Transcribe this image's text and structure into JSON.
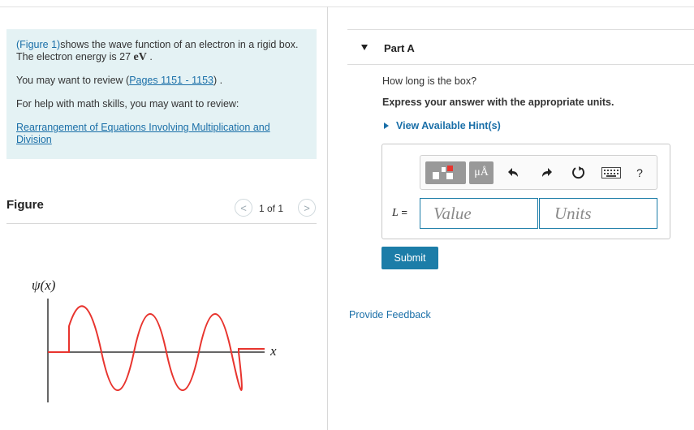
{
  "info": {
    "figure_link": "(Figure 1)",
    "line1_rest": "shows the wave function of an electron in a rigid box. The electron energy is 27 ",
    "energy_unit": "eV",
    "line1_end": " .",
    "review_prefix": "You may want to review (",
    "review_link": "Pages 1151 - 1153",
    "review_suffix": ") .",
    "math_help": "For help with math skills, you may want to review:",
    "math_link": "Rearrangement of Equations Involving Multiplication and Division"
  },
  "figure": {
    "title": "Figure",
    "counter": "1 of 1",
    "prev_glyph": "<",
    "next_glyph": ">",
    "y_label": "ψ(x)",
    "x_label": "x"
  },
  "part": {
    "title": "Part A",
    "question": "How long is the box?",
    "instruction": "Express your answer with the appropriate units.",
    "hint": "View Available Hint(s)"
  },
  "answer": {
    "units_icon": "μÅ",
    "help_glyph": "?",
    "label_var": "L",
    "label_eq": " =",
    "value_placeholder": "Value",
    "units_placeholder": "Units"
  },
  "toolbar_icons": [
    "templates-icon",
    "units-icon",
    "undo-icon",
    "redo-icon",
    "reset-icon",
    "keyboard-icon",
    "help-icon"
  ],
  "submit_label": "Submit",
  "feedback_label": "Provide Feedback",
  "colors": {
    "accent": "#1c7da8",
    "link": "#1a6fa8",
    "info_bg": "#e4f2f4",
    "wave": "#e8342e"
  }
}
